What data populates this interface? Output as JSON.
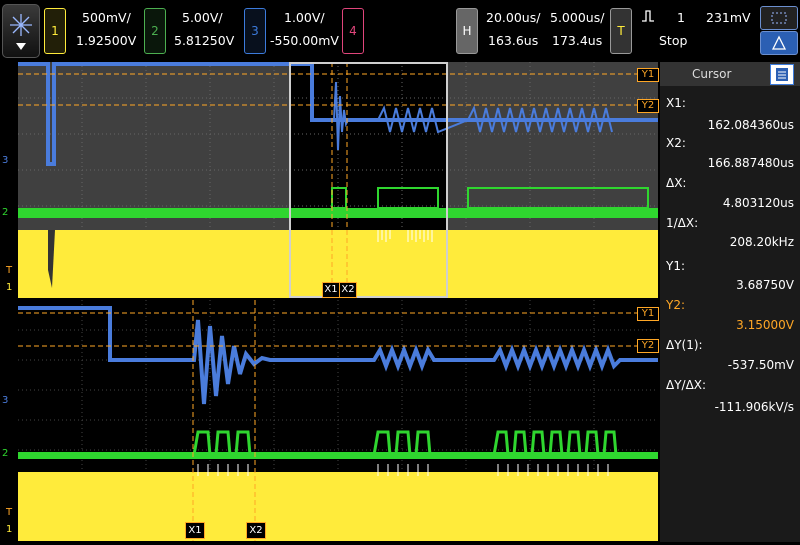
{
  "channels": [
    {
      "num": "1",
      "scale": "500mV/",
      "offset": "1.92500V",
      "color": "#ffeb3b"
    },
    {
      "num": "2",
      "scale": "5.00V/",
      "offset": "5.81250V",
      "color": "#4caf50"
    },
    {
      "num": "3",
      "scale": "1.00V/",
      "offset": "-550.00mV",
      "color": "#3c7bdc"
    },
    {
      "num": "4",
      "scale": "",
      "offset": "",
      "color": "#e0457b"
    }
  ],
  "horizontal": {
    "label": "H",
    "timebase": "20.00us/",
    "position": "163.6us",
    "zoom_timebase": "5.000us/",
    "zoom_position": "173.4us"
  },
  "trigger": {
    "label": "T",
    "slope_icon": "rising-edge-icon",
    "source": "1",
    "level": "231mV",
    "state": "Stop"
  },
  "cursor_panel": {
    "title": "Cursor",
    "rows": [
      {
        "label": "X1:",
        "value": "162.084360us"
      },
      {
        "label": "X2:",
        "value": "166.887480us"
      },
      {
        "label": "ΔX:",
        "value": "4.803120us"
      },
      {
        "label": "1/ΔX:",
        "value": "208.20kHz"
      },
      {
        "label": "Y1:",
        "value": "3.68750V"
      },
      {
        "label": "Y2:",
        "value": "3.15000V"
      },
      {
        "label": "ΔY(1):",
        "value": "-537.50mV"
      },
      {
        "label": "ΔY/ΔX:",
        "value": "-111.906kV/s"
      }
    ]
  },
  "markers": {
    "y1": "Y1",
    "y2": "Y2",
    "x1": "X1",
    "x2": "X2",
    "ch1": "1",
    "ch2": "2",
    "ch3": "3",
    "trig": "T"
  }
}
